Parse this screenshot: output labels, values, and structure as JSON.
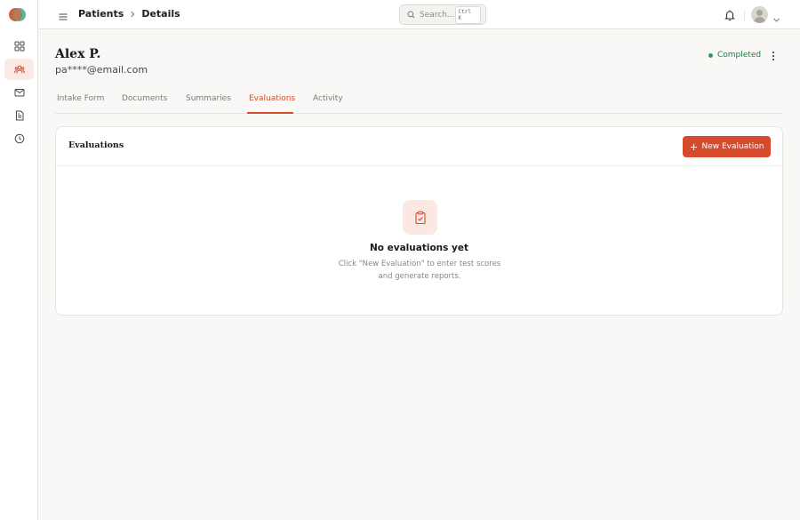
{
  "sidebar": {
    "logo": "brand-logo",
    "items": [
      {
        "name": "dashboard",
        "icon": "grid-icon",
        "active": false
      },
      {
        "name": "patients",
        "icon": "users-icon",
        "active": true
      },
      {
        "name": "messages",
        "icon": "mail-icon",
        "active": false
      },
      {
        "name": "documents",
        "icon": "file-icon",
        "active": false
      },
      {
        "name": "history",
        "icon": "clock-icon",
        "active": false
      }
    ]
  },
  "header": {
    "breadcrumb": [
      "Patients",
      "Details"
    ],
    "search_placeholder": "Search...",
    "search_shortcut": "Ctrl K"
  },
  "patient": {
    "name": "Alex P.",
    "email": "pa****@email.com",
    "status": "Completed"
  },
  "tabs": [
    {
      "label": "Intake Form",
      "active": false
    },
    {
      "label": "Documents",
      "active": false
    },
    {
      "label": "Summaries",
      "active": false
    },
    {
      "label": "Evaluations",
      "active": true
    },
    {
      "label": "Activity",
      "active": false
    }
  ],
  "evaluations": {
    "title": "Evaluations",
    "new_button": "New Evaluation",
    "empty_title": "No evaluations yet",
    "empty_desc": "Click \"New Evaluation\" to enter test scores and generate reports."
  },
  "colors": {
    "accent": "#d64a2e",
    "accent_soft": "#fce8e3",
    "status_green": "#27a05f",
    "background": "#f9f8f6"
  }
}
